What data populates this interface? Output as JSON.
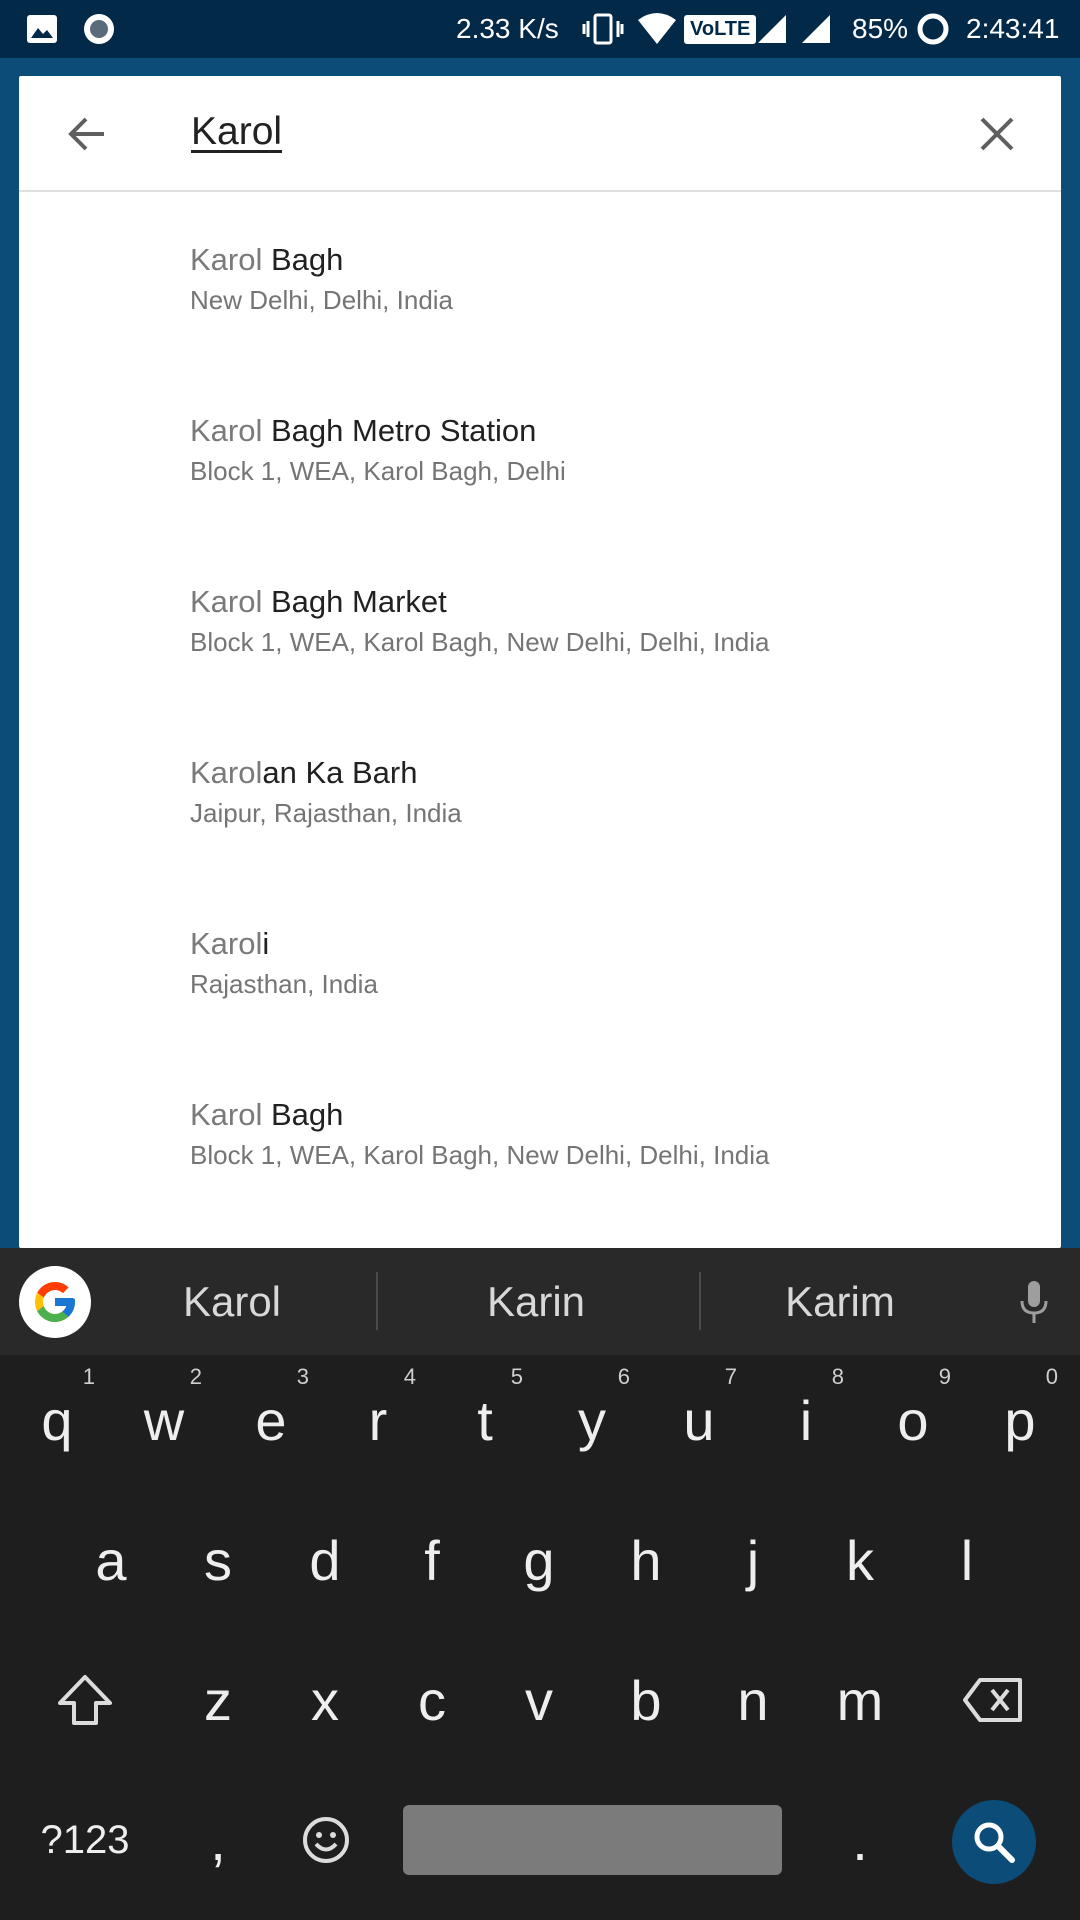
{
  "status_bar": {
    "network_speed": "2.33 K/s",
    "volte_label": "VoLTE",
    "battery": "85%",
    "time": "2:43:41"
  },
  "search": {
    "query": "Karol",
    "back_icon": "back-arrow-icon",
    "clear_icon": "close-icon"
  },
  "results": [
    {
      "match": "Karol",
      "rest": " Bagh",
      "subtitle": "New Delhi, Delhi, India"
    },
    {
      "match": "Karol",
      "rest": " Bagh Metro Station",
      "subtitle": "Block 1, WEA, Karol Bagh, Delhi"
    },
    {
      "match": "Karol",
      "rest": " Bagh Market",
      "subtitle": "Block 1, WEA, Karol Bagh, New Delhi, Delhi, India"
    },
    {
      "match": "Karol",
      "rest": "an Ka Barh",
      "subtitle": "Jaipur, Rajasthan, India"
    },
    {
      "match": "Karol",
      "rest": "i",
      "subtitle": "Rajasthan, India"
    },
    {
      "match": "Karol",
      "rest": " Bagh",
      "subtitle": "Block 1, WEA, Karol Bagh, New Delhi, Delhi, India"
    }
  ],
  "keyboard": {
    "suggestions": [
      "Karol",
      "Karin",
      "Karim"
    ],
    "row1": [
      "q",
      "w",
      "e",
      "r",
      "t",
      "y",
      "u",
      "i",
      "o",
      "p"
    ],
    "row1_hints": [
      "1",
      "2",
      "3",
      "4",
      "5",
      "6",
      "7",
      "8",
      "9",
      "0"
    ],
    "row2": [
      "a",
      "s",
      "d",
      "f",
      "g",
      "h",
      "j",
      "k",
      "l"
    ],
    "row3": [
      "z",
      "x",
      "c",
      "v",
      "b",
      "n",
      "m"
    ],
    "symbols_label": "?123",
    "comma": ",",
    "period": "."
  },
  "colors": {
    "app_blue": "#0b4c78",
    "status_bar": "#022947",
    "keyboard_bg": "#1e1e1e"
  }
}
